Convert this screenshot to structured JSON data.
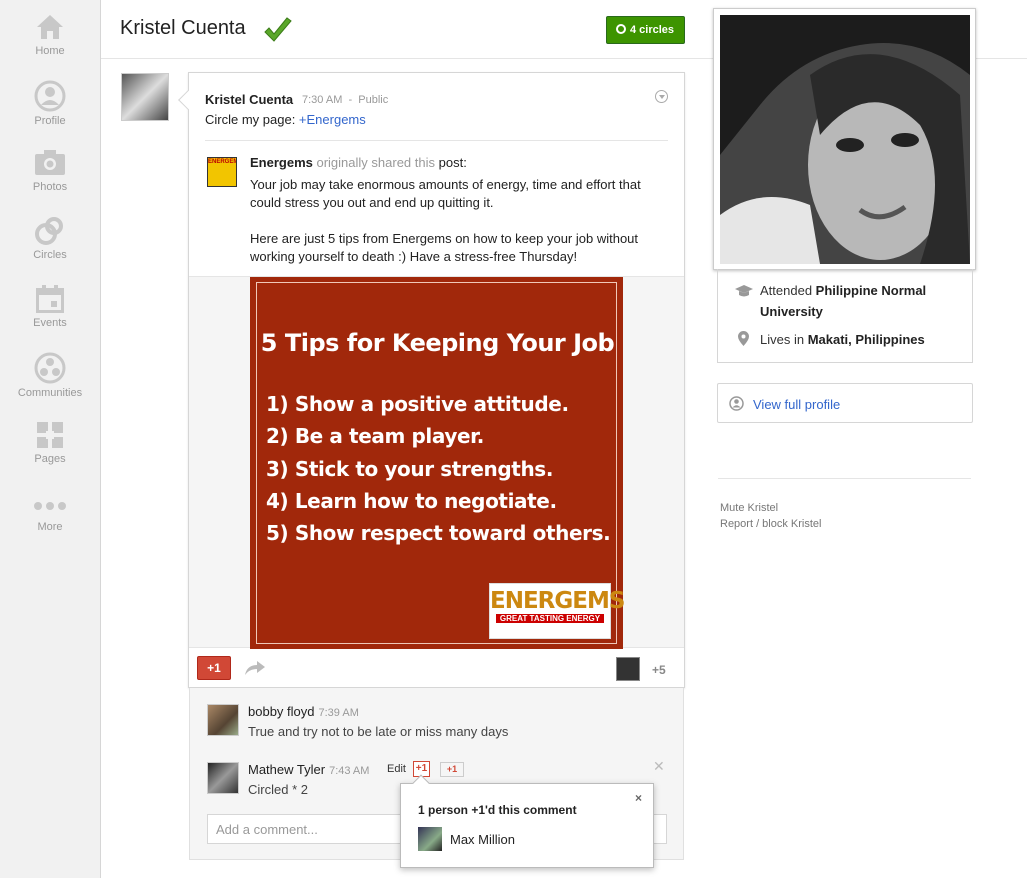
{
  "nav": {
    "items": [
      {
        "label": "Home",
        "icon": "home-icon"
      },
      {
        "label": "Profile",
        "icon": "profile-icon"
      },
      {
        "label": "Photos",
        "icon": "camera-icon"
      },
      {
        "label": "Circles",
        "icon": "circles-icon"
      },
      {
        "label": "Events",
        "icon": "calendar-icon"
      },
      {
        "label": "Communities",
        "icon": "communities-icon"
      },
      {
        "label": "Pages",
        "icon": "pages-icon"
      },
      {
        "label": "More",
        "icon": "more-dots-icon"
      }
    ]
  },
  "header": {
    "name": "Kristel Cuenta",
    "circles_label": "4 circles"
  },
  "profile": {
    "education_prefix": "Attended ",
    "education": "Philippine Normal University",
    "location_prefix": "Lives in ",
    "location": "Makati, Philippines",
    "view_full_profile": "View full profile",
    "mute": "Mute Kristel",
    "report": "Report / block Kristel"
  },
  "post": {
    "author": "Kristel Cuenta",
    "time": "7:30 AM",
    "separator": "-",
    "visibility": "Public",
    "text_prefix": "Circle my page: ",
    "text_link": "+Energems",
    "shared": {
      "source": "Energems",
      "mid": " originally shared this ",
      "post_word": "post",
      "colon": ":",
      "body1": "Your job may take enormous amounts of energy, time and effort that could stress you out and end up quitting it.",
      "body2": "Here are just 5 tips from Energems on how to keep your job without working yourself to death :) Have a stress-free Thursday!"
    },
    "image": {
      "title": "5 Tips for Keeping Your Job",
      "tips": [
        "1) Show a positive attitude.",
        "2) Be a team player.",
        "3) Stick to your strengths.",
        "4) Learn how to negotiate.",
        "5) Show respect toward others."
      ],
      "logo_text": "ENERGEMS",
      "logo_tagline": "GREAT TASTING ENERGY",
      "background_color": "#a1280b"
    },
    "plus_one_label": "+1",
    "plus_count": "+5"
  },
  "comments": [
    {
      "name": "bobby floyd",
      "time": "7:39 AM",
      "text": "True and try not to be late or miss many days"
    },
    {
      "name": "Mathew Tyler",
      "time": "7:43 AM",
      "text": "Circled * 2",
      "edit": "Edit",
      "plus": "+1",
      "plus_btn": "+1"
    }
  ],
  "add_comment_placeholder": "Add a comment...",
  "popup": {
    "title": "1 person +1'd this comment",
    "close": "×",
    "person": "Max Million"
  },
  "colors": {
    "accent_green": "#3d9400",
    "plus_red": "#d14836",
    "link_blue": "#3366cc"
  }
}
